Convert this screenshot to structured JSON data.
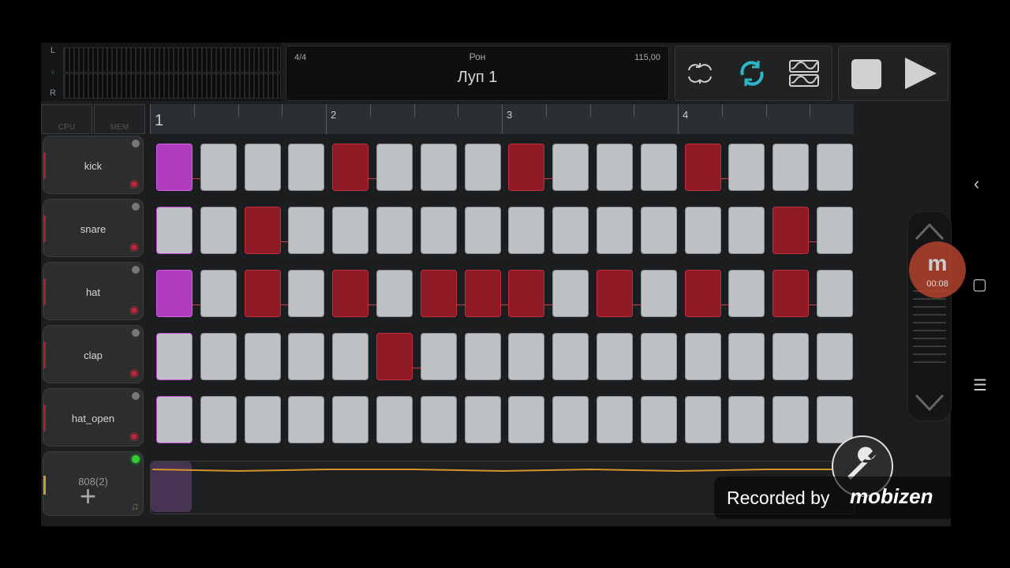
{
  "meter": {
    "left_label": "L",
    "right_label": "R",
    "led": "○"
  },
  "info": {
    "time_signature": "4/4",
    "artist": "Рон",
    "loop_name": "Луп 1",
    "tempo": "115,00"
  },
  "tools": [
    "loop-record-icon",
    "repeat-icon",
    "wave-edit-icon"
  ],
  "transport": {
    "stop": "stop-icon",
    "play": "play-icon"
  },
  "sys": {
    "cpu": "CPU",
    "mem": "MEM"
  },
  "ruler": {
    "bars": [
      "1",
      "2",
      "3",
      "4"
    ]
  },
  "tracks": [
    {
      "name": "kick"
    },
    {
      "name": "snare"
    },
    {
      "name": "hat"
    },
    {
      "name": "clap"
    },
    {
      "name": "hat_open"
    }
  ],
  "add_track": {
    "name": "808(2)",
    "plus": "+"
  },
  "steps": [
    [
      1,
      0,
      0,
      0,
      1,
      0,
      0,
      0,
      1,
      0,
      0,
      0,
      1,
      0,
      0,
      0
    ],
    [
      0,
      0,
      1,
      0,
      0,
      0,
      0,
      0,
      0,
      0,
      0,
      0,
      0,
      0,
      1,
      0
    ],
    [
      1,
      0,
      1,
      0,
      1,
      0,
      1,
      1,
      1,
      0,
      1,
      0,
      1,
      0,
      1,
      0
    ],
    [
      0,
      0,
      0,
      0,
      0,
      1,
      0,
      0,
      0,
      0,
      0,
      0,
      0,
      0,
      0,
      0
    ],
    [
      0,
      0,
      0,
      0,
      0,
      0,
      0,
      0,
      0,
      0,
      0,
      0,
      0,
      0,
      0,
      0
    ]
  ],
  "colors": {
    "active": "#8d1a24",
    "start": "#b03cc0",
    "inactive": "#bfc2c5",
    "automation": "#d4952a"
  },
  "recorder": {
    "logo": "m",
    "time": "00:08"
  },
  "watermark": {
    "text": "Recorded by",
    "brand": "mobizen"
  }
}
